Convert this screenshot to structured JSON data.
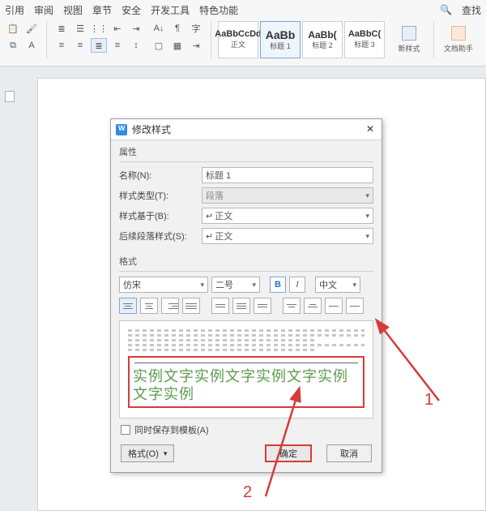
{
  "ribbon": {
    "tabs": [
      "引用",
      "审阅",
      "视图",
      "章节",
      "安全",
      "开发工具",
      "特色功能"
    ],
    "search": "查找",
    "styles": [
      {
        "preview": "AaBbCcDd",
        "label": "正文"
      },
      {
        "preview": "AaBb",
        "label": "标题 1"
      },
      {
        "preview": "AaBb(",
        "label": "标题 2"
      },
      {
        "preview": "AaBbC(",
        "label": "标题 3"
      }
    ],
    "new_style": "新样式",
    "doc_assist": "文档助手"
  },
  "dialog": {
    "title": "修改样式",
    "sect_props": "属性",
    "sect_format": "格式",
    "labels": {
      "name": "名称(N):",
      "type": "样式类型(T):",
      "based": "样式基于(B):",
      "follow": "后续段落样式(S):"
    },
    "values": {
      "name": "标题 1",
      "type": "段落",
      "based": "正文",
      "follow": "正文"
    },
    "font_name": "仿宋",
    "font_size": "二号",
    "bold": "B",
    "italic": "I",
    "lang": "中文",
    "sample": "实例文字实例文字实例文字实例文字实例",
    "save_tpl": "同时保存到模板(A)",
    "format_menu": "格式(O)",
    "ok": "确定",
    "cancel": "取消"
  },
  "annot": {
    "n1": "1",
    "n2": "2"
  }
}
